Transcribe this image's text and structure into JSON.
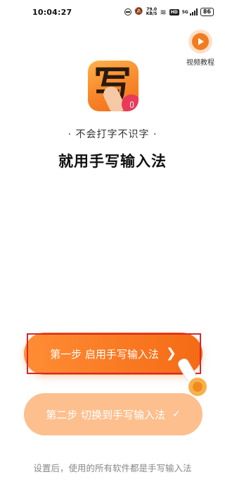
{
  "status_bar": {
    "time": "10:04:27",
    "net_speed_value": "79.0",
    "net_speed_unit": "KB/S",
    "network_badge": "HD",
    "signal_label": "5G",
    "battery": "86"
  },
  "video_tutorial": {
    "label": "视频教程",
    "icon": "play-icon"
  },
  "app_icon": {
    "glyph": "写",
    "icon": "microphone-icon"
  },
  "slogan": "· 不会打字不识字 ·",
  "headline": "就用手写输入法",
  "step1": {
    "label": "第一步 启用手写输入法",
    "icon": "chevron-right-icon",
    "glyph": "❯"
  },
  "step2": {
    "label": "第二步 切换到手写输入法",
    "icon": "check-icon",
    "glyph": "✓"
  },
  "footer_note": "设置后，使用的所有软件都是手写输入法",
  "colors": {
    "primary": "#f56a14",
    "primary_light": "#fdbf8e",
    "highlight_outline": "#d8262c",
    "mic_badge": "#e93a5b"
  }
}
